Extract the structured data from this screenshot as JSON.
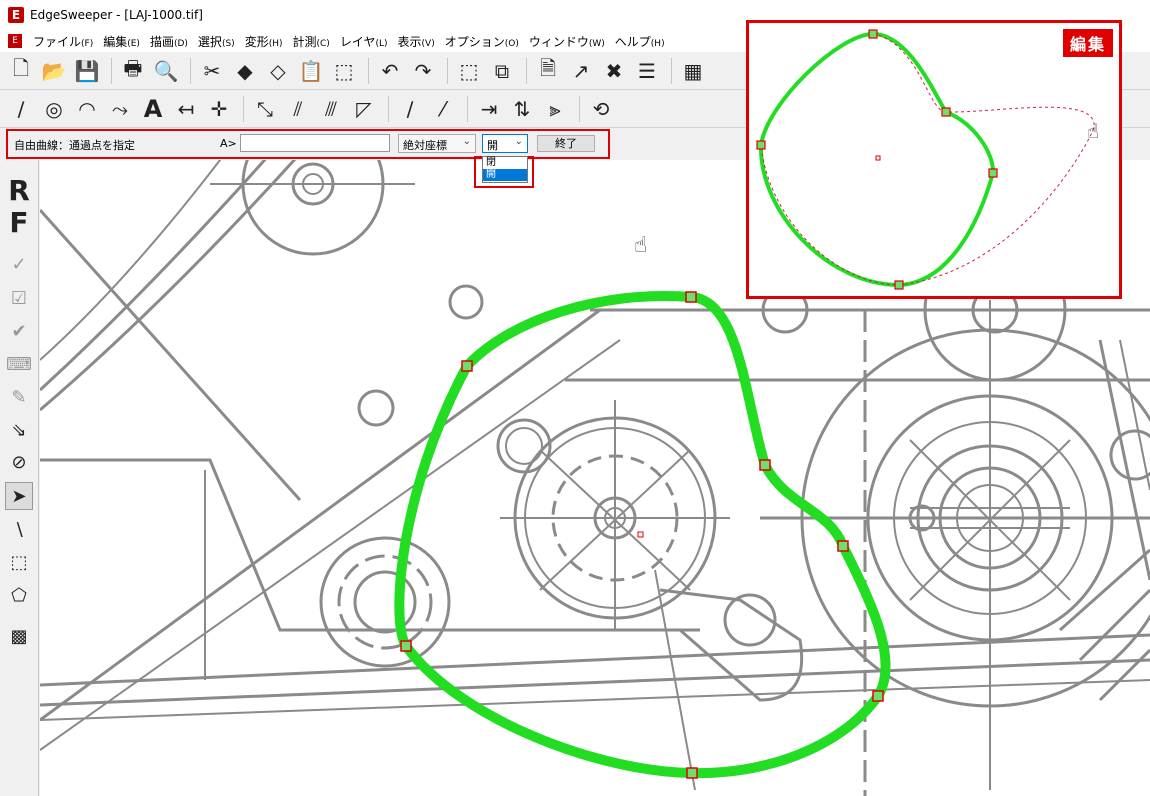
{
  "window": {
    "title": "EdgeSweeper - [LAJ-1000.tif]",
    "logo_letter": "E"
  },
  "menu": [
    {
      "label": "ファイル",
      "key": "(F)"
    },
    {
      "label": "編集",
      "key": "(E)"
    },
    {
      "label": "描画",
      "key": "(D)"
    },
    {
      "label": "選択",
      "key": "(S)"
    },
    {
      "label": "変形",
      "key": "(H)"
    },
    {
      "label": "計測",
      "key": "(C)"
    },
    {
      "label": "レイヤ",
      "key": "(L)"
    },
    {
      "label": "表示",
      "key": "(V)"
    },
    {
      "label": "オプション",
      "key": "(O)"
    },
    {
      "label": "ウィンドウ",
      "key": "(W)"
    },
    {
      "label": "ヘルプ",
      "key": "(H)"
    }
  ],
  "toolbar1": [
    "new-file-icon",
    "open-folder-icon",
    "save-icon",
    "|",
    "print-icon",
    "print-preview-icon",
    "|",
    "cut-icon",
    "eraser-icon",
    "eraser-light-icon",
    "paste-icon",
    "select-rect-icon",
    "|",
    "undo-icon",
    "redo-icon",
    "|",
    "group-icon",
    "ungroup-icon",
    "|",
    "add-page-icon",
    "join-lines-icon",
    "cross-lines-icon",
    "list-icon",
    "|",
    "grid-icon"
  ],
  "toolbar2": [
    "line-tool-icon",
    "circle-tool-icon",
    "arc-tool-icon",
    "polyline-tool-icon",
    "text-tool-icon",
    "dimension-tool-icon",
    "crosshair-tool-icon",
    "|",
    "hatch-tool-icon",
    "offset-tool-icon",
    "fillet-tool-icon",
    "corner-tool-icon",
    "|",
    "extend-tool-icon",
    "trim-tool-icon",
    "|",
    "move-tool-icon",
    "copy-tool-icon",
    "mirror-tool-icon",
    "|",
    "rotate-tool-icon"
  ],
  "command": {
    "prompt": "自由曲線：通過点を指定",
    "coord_label": "A>",
    "coord_value": "",
    "coord_mode": "絶対座標",
    "open_close_value": "開",
    "end_label": "終了",
    "options": [
      "閉",
      "開"
    ],
    "selected_option": 1
  },
  "palette": {
    "letter_r": "R",
    "letter_f": "F"
  },
  "inset": {
    "badge": "編集"
  },
  "colors": {
    "accent_red": "#e00000",
    "curve_green": "#22dd22",
    "drawing_gray": "#8a8a8a"
  }
}
